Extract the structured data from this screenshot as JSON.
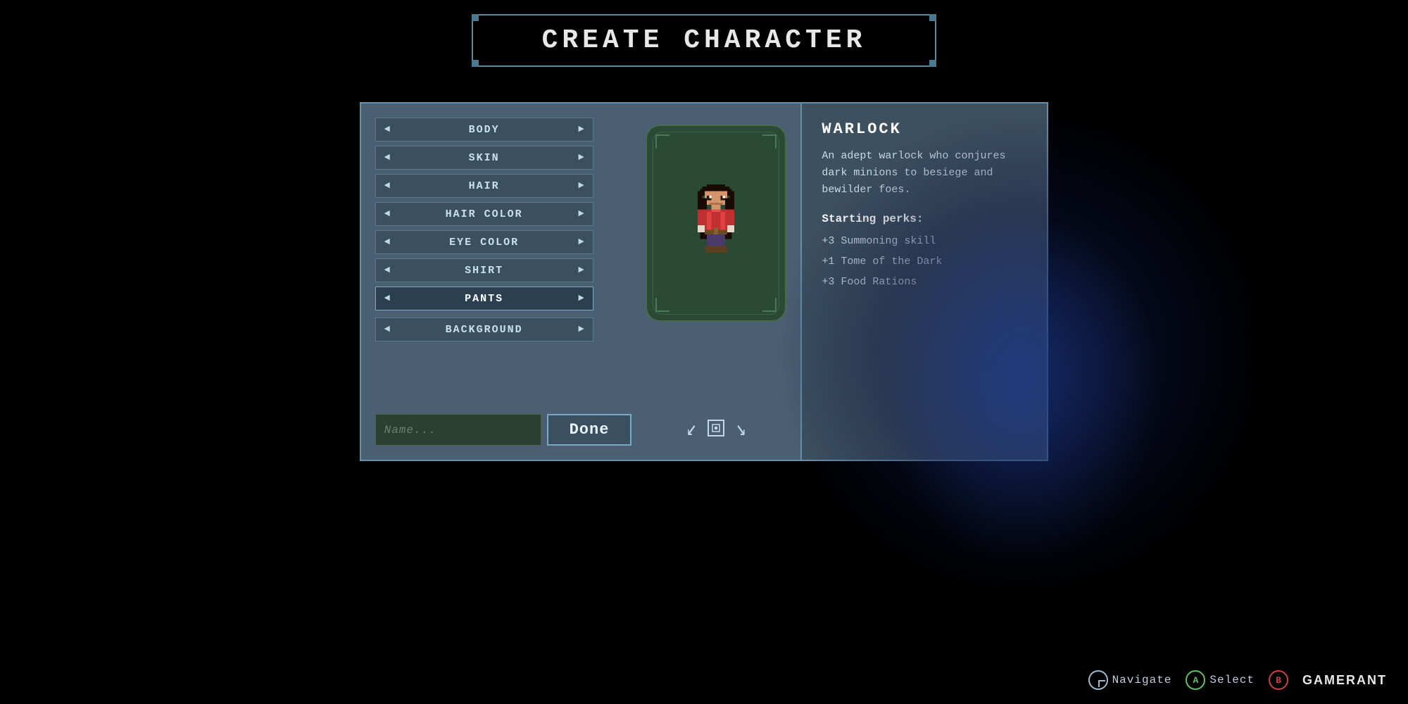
{
  "title": "CREATE CHARACTER",
  "options": [
    {
      "label": "BODY",
      "active": false
    },
    {
      "label": "SKIN",
      "active": false
    },
    {
      "label": "HAIR",
      "active": false
    },
    {
      "label": "HAIR COLOR",
      "active": false
    },
    {
      "label": "EYE COLOR",
      "active": false
    },
    {
      "label": "SHIRT",
      "active": false
    },
    {
      "label": "PANTS",
      "active": true
    }
  ],
  "background_label": "BACKGROUND",
  "name_placeholder": "Name...",
  "done_button": "Done",
  "class": {
    "name": "WARLOCK",
    "description": "An adept warlock who conjures dark minions to besiege and bewilder foes.",
    "perks_label": "Starting perks:",
    "perks": [
      "+3 Summoning skill",
      "+1 Tome of the Dark",
      "+3 Food Rations"
    ]
  },
  "hud": {
    "navigate_label": "Navigate",
    "select_label": "A Select",
    "b_label": "B",
    "a_label": "A",
    "gamerant": "GAMERANT"
  },
  "colors": {
    "panel_bg": "#4a5f72",
    "panel_border": "#6a8fa5",
    "option_bg": "#3a5060",
    "active_option_bg": "#2a4050",
    "char_frame_bg": "#2a4a35",
    "info_bg": "#3d5060",
    "name_bg": "#2a4030",
    "accent": "#c8e0f0"
  }
}
